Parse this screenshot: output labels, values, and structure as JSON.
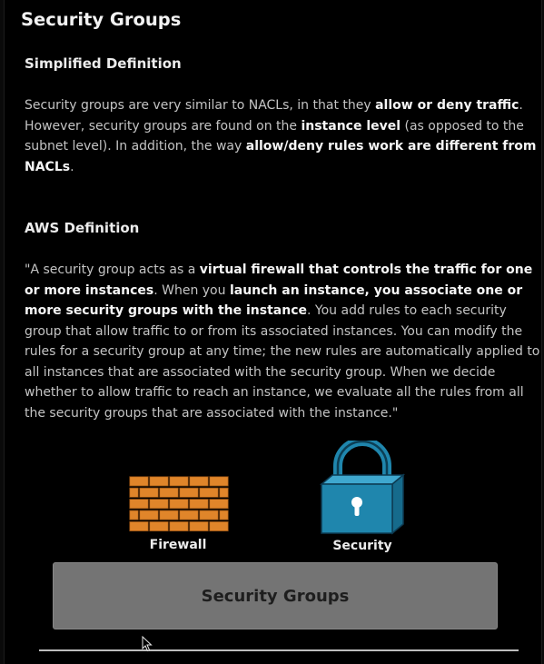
{
  "title": "Security Groups",
  "simplified": {
    "heading": "Simplified Definition",
    "p": [
      {
        "t": "Security groups are very similar to NACLs, in that they ",
        "b": false
      },
      {
        "t": "allow or deny traffic",
        "b": true
      },
      {
        "t": ". However, security groups are found on the ",
        "b": false
      },
      {
        "t": "instance level",
        "b": true
      },
      {
        "t": " (as opposed to the subnet level). In addition, the way ",
        "b": false
      },
      {
        "t": "allow/deny rules work are different from NACLs",
        "b": true
      },
      {
        "t": ".",
        "b": false
      }
    ]
  },
  "aws": {
    "heading": "AWS Definition",
    "p": [
      {
        "t": "\"A security group acts as a ",
        "b": false
      },
      {
        "t": "virtual firewall that controls the traffic for one or more instances",
        "b": true
      },
      {
        "t": ". When you ",
        "b": false
      },
      {
        "t": "launch an instance, you associate one or more security groups with the instance",
        "b": true
      },
      {
        "t": ". You add rules to each security group that allow traffic to or from its associated instances. You can modify the rules for a security group at any time; the new rules are automatically applied to all instances that are associated with the security group. When we decide whether to allow traffic to reach an instance, we evaluate all the rules from all the security groups that are associated with the instance.\"",
        "b": false
      }
    ]
  },
  "icons": {
    "firewall": {
      "label": "Firewall",
      "icon": "brick-wall-icon",
      "color": "#e0852a"
    },
    "security": {
      "label": "Security",
      "icon": "padlock-icon",
      "color": "#1f86ad"
    }
  },
  "button": {
    "label": "Security Groups"
  }
}
